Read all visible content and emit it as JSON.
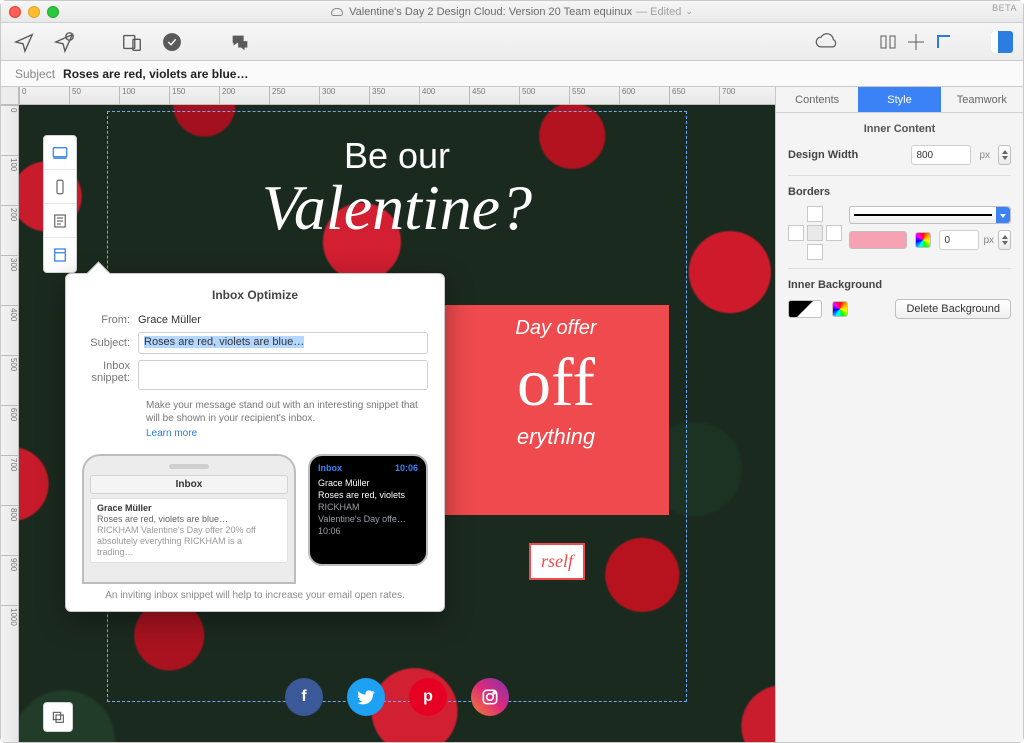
{
  "window": {
    "title": "Valentine's Day 2 Design Cloud: Version 20 Team equinux",
    "edited": "— Edited",
    "beta": "BETA"
  },
  "subject": {
    "label": "Subject",
    "value": "Roses are red, violets are blue…"
  },
  "ruler_h": [
    "0",
    "50",
    "100",
    "150",
    "200",
    "250",
    "300",
    "350",
    "400",
    "450",
    "500",
    "550",
    "600",
    "650",
    "700"
  ],
  "ruler_v": [
    "0",
    "100",
    "200",
    "300",
    "400",
    "500",
    "600",
    "700",
    "800",
    "900",
    "1000"
  ],
  "hero": {
    "line1": "Be our",
    "line2": "Valentine?"
  },
  "offer": {
    "line1": "Day offer",
    "line2": "off",
    "line3": "erything",
    "cta_fragment": "rself"
  },
  "social": [
    "f",
    "t",
    "p",
    "ig"
  ],
  "popover": {
    "title": "Inbox Optimize",
    "from_label": "From:",
    "from_value": "Grace Müller",
    "subject_label": "Subject:",
    "subject_value": "Roses are red, violets are blue…",
    "snippet_label": "Inbox snippet:",
    "hint": "Make your message stand out with an interesting snippet that will be shown in your recipient's inbox.",
    "learn_more": "Learn more",
    "footer": "An inviting inbox snippet will help to increase your email open rates."
  },
  "phone_preview": {
    "header": "Inbox",
    "sender": "Grace Müller",
    "subject": "Roses are red, violets are blue…",
    "body": "RICKHAM Valentine's Day offer 20% off absolutely everything RICKHAM is a trading…"
  },
  "watch_preview": {
    "app": "Inbox",
    "time": "10:06",
    "l1": "Grace Müller",
    "l2": "Roses are red, violets",
    "l3": "RICKHAM",
    "l4": "Valentine's Day offe…",
    "l5": "10:06"
  },
  "inspector": {
    "tabs": {
      "contents": "Contents",
      "style": "Style",
      "teamwork": "Teamwork"
    },
    "inner_content": "Inner Content",
    "design_width_label": "Design Width",
    "design_width_value": "800",
    "px": "px",
    "borders": "Borders",
    "border_width": "0",
    "inner_bg": "Inner Background",
    "delete_bg": "Delete Background"
  }
}
